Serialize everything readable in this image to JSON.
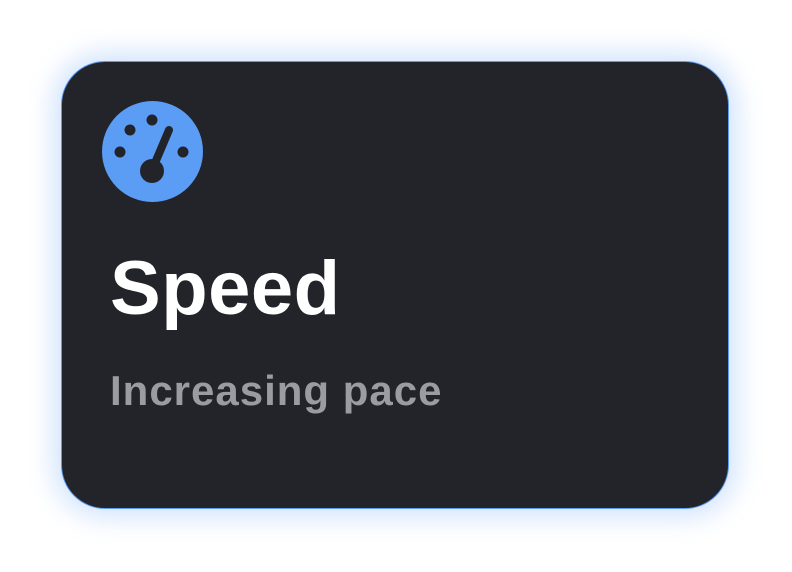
{
  "card": {
    "icon": "speedometer-icon",
    "title": "Speed",
    "subtitle": "Increasing pace"
  },
  "colors": {
    "card_background": "#222429",
    "accent": "#5b9cf5",
    "title": "#ffffff",
    "subtitle": "#9a9ca2"
  }
}
